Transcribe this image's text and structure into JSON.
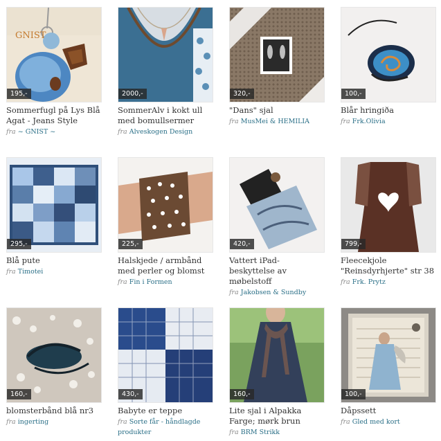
{
  "products": [
    {
      "title": "Sommerfugl på Lys Blå Agat - Jeans Style",
      "price": "195,-",
      "fra": "fra",
      "seller": "~ GNIST ~",
      "image_text": "GNIST",
      "image": "blue agate pendant necklace with copper butterfly"
    },
    {
      "title": "SommerAlv i kokt ull med bomullsermer",
      "price": "2000,-",
      "fra": "fra",
      "seller": "Alveskogen Design",
      "image": "blue boiled wool dress with floral sleeves and necklace"
    },
    {
      "title": "\"Dans\" sjal",
      "price": "320,-",
      "fra": "fra",
      "seller": "MusMei & HEMILIA",
      "image": "brown knitted shawl with lace and photo"
    },
    {
      "title": "Blår hringiða",
      "price": "100,-",
      "fra": "fra",
      "seller": "Frk.Olivia",
      "image": "blue swirl glass ring"
    },
    {
      "title": "Blå pute",
      "price": "295,-",
      "fra": "fra",
      "seller": "Timotei",
      "image": "blue patchwork pillow"
    },
    {
      "title": "Halskjede / armbånd med perler og blomst",
      "price": "225,-",
      "fra": "fra",
      "seller": "Fin i Formen",
      "image": "brown crocheted bracelet with pearls on wrist"
    },
    {
      "title": "Vattert iPad-beskyttelse av møbelstoff",
      "price": "420,-",
      "fra": "fra",
      "seller": "Jakobsen & Sundby",
      "image": "quilted ipad cover in upholstery fabric"
    },
    {
      "title": "Fleecekjole \"Reinsdyrhjerte\" str 38",
      "price": "799,-",
      "fra": "fra",
      "seller": "Frk. Prytz",
      "image": "brown fleece dress with white heart"
    },
    {
      "title": "blomsterbånd blå nr3",
      "price": "160,-",
      "fra": "fra",
      "seller": "ingerting",
      "image": "blue flower ribbon with sequins"
    },
    {
      "title": "Babyte er teppe",
      "price": "430,-",
      "fra": "fra",
      "seller": "Sorte får - håndlagde produkter",
      "image": "blue and white crocheted blanket"
    },
    {
      "title": "Lite sjal i Alpakka Farge; mørk brun",
      "price": "160,-",
      "fra": "fra",
      "seller": "BRM Strikk",
      "image": "woman wearing small brown alpaca scarf"
    },
    {
      "title": "Dåpssett",
      "price": "100,-",
      "fra": "fra",
      "seller": "Gled med kort",
      "image": "baptism card with angel illustration"
    }
  ]
}
